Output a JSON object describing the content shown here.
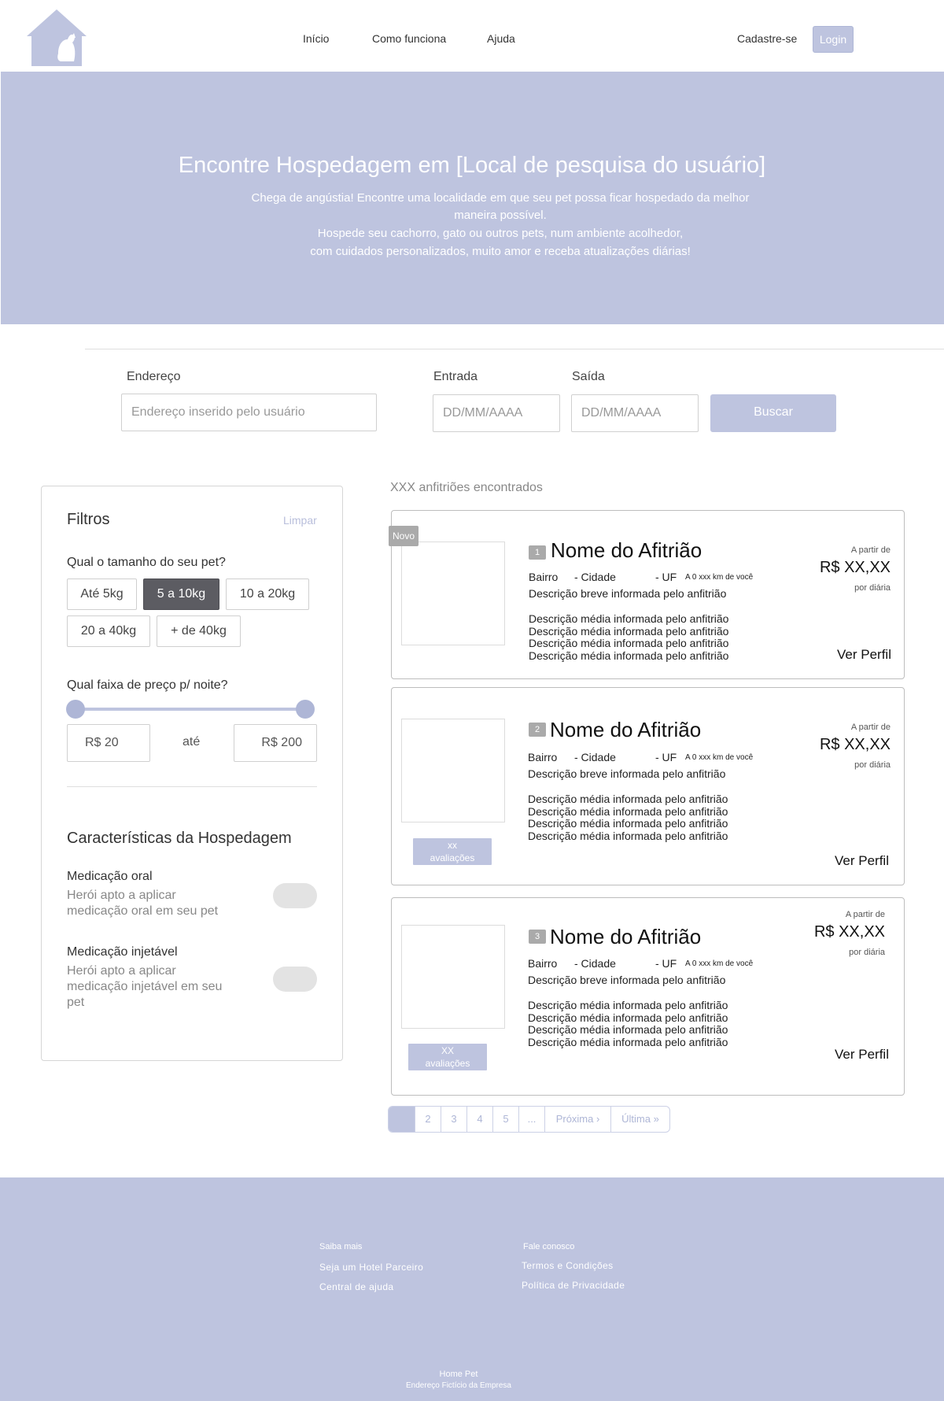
{
  "header": {
    "logo_icon": "house-dog-logo-icon",
    "nav": [
      {
        "label": "Início"
      },
      {
        "label": "Como funciona"
      },
      {
        "label": "Ajuda"
      }
    ],
    "signup_label": "Cadastre-se",
    "login_label": "Login"
  },
  "hero": {
    "title": "Encontre Hospedagem em [Local de pesquisa do usuário]",
    "line1": "Chega de angústia! Encontre uma localidade em que seu pet possa ficar hospedado da melhor",
    "line2": "maneira possível.",
    "line3": "Hospede seu cachorro, gato ou outros pets, num ambiente acolhedor,",
    "line4": "com cuidados personalizados, muito amor e receba atualizações diárias!"
  },
  "search": {
    "address_label": "Endereço",
    "address_value": "Endereço inserido pelo usuário",
    "checkin_label": "Entrada",
    "checkin_placeholder": "DD/MM/AAAA",
    "checkout_label": "Saída",
    "checkout_placeholder": "DD/MM/AAAA",
    "search_button": "Buscar"
  },
  "filters": {
    "title": "Filtros",
    "clear_label": "Limpar",
    "size_question": "Qual o tamanho do seu pet?",
    "sizes": [
      {
        "label": "Até 5kg",
        "selected": false
      },
      {
        "label": "5 a 10kg",
        "selected": true
      },
      {
        "label": "10 a 20kg",
        "selected": false
      },
      {
        "label": "20 a 40kg",
        "selected": false
      },
      {
        "label": "+ de 40kg",
        "selected": false
      }
    ],
    "price_question": "Qual faixa de preço p/ noite?",
    "price_min": "R$ 20",
    "price_to": "até",
    "price_max": "R$ 200",
    "slider_min_fraction": 0,
    "slider_max_fraction": 1,
    "features_title": "Características da Hospedagem",
    "features": [
      {
        "name": "Medicação oral",
        "desc1": "Herói apto a aplicar",
        "desc2": "medicação oral em seu pet",
        "desc3": "",
        "enabled": false
      },
      {
        "name": "Medicação injetável",
        "desc1": "Herói apto a aplicar",
        "desc2": "medicação injetável em seu",
        "desc3": "pet",
        "enabled": false
      }
    ]
  },
  "results": {
    "count_label": "XXX anfitriões encontrados",
    "new_badge": "Novo",
    "cards": [
      {
        "rank": "1",
        "name": "Nome do Afitrião",
        "bairro": "Bairro",
        "cidade": "- Cidade",
        "uf": "- UF",
        "distance": "A 0 xxx km de você",
        "desc_short": "Descrição breve informada pelo anfitrião",
        "desc_medium": [
          "Descrição média informada pelo anfitrião",
          "Descrição média informada pelo anfitrião",
          "Descrição média informada pelo anfitrião",
          "Descrição média informada pelo anfitrião"
        ],
        "price_from": "A partir de",
        "price": "R$ XX,XX",
        "per_night": "por diária",
        "profile_link": "Ver Perfil"
      },
      {
        "rank": "2",
        "name": "Nome do Afitrião",
        "bairro": "Bairro",
        "cidade": "- Cidade",
        "uf": "- UF",
        "distance": "A 0 xxx km de você",
        "desc_short": "Descrição breve informada pelo anfitrião",
        "desc_medium": [
          "Descrição média informada pelo anfitrião",
          "Descrição média informada pelo anfitrião",
          "Descrição média informada pelo anfitrião",
          "Descrição média informada pelo anfitrião"
        ],
        "price_from": "A partir de",
        "price": "R$ XX,XX",
        "per_night": "por diária",
        "profile_link": "Ver Perfil",
        "reviews_line1": "xx",
        "reviews_line2": "avaliações"
      },
      {
        "rank": "3",
        "name": "Nome do Afitrião",
        "bairro": "Bairro",
        "cidade": "- Cidade",
        "uf": "- UF",
        "distance": "A 0 xxx km de você",
        "desc_short": "Descrição breve informada pelo anfitrião",
        "desc_medium": [
          "Descrição média informada pelo anfitrião",
          "Descrição média informada pelo anfitrião",
          "Descrição média informada pelo anfitrião",
          "Descrição média informada pelo anfitrião"
        ],
        "price_from": "A partir de",
        "price": "R$ XX,XX",
        "per_night": "por diária",
        "profile_link": "Ver Perfil",
        "reviews_line1": "XX",
        "reviews_line2": "avaliações"
      }
    ]
  },
  "pagination": {
    "current": "",
    "pages": [
      "2",
      "3",
      "4",
      "5",
      "..."
    ],
    "next": "Próxima ›",
    "last": "Última »"
  },
  "footer": {
    "col1_title": "Saiba mais",
    "col1_links": [
      "Seja um Hotel Parceiro",
      "Central de ajuda"
    ],
    "col2_title": "Fale conosco",
    "col2_links": [
      "Termos e Condições",
      "Política de Privacidade"
    ],
    "company": "Home Pet",
    "address": "Endereço Fictício da Empresa"
  },
  "colors": {
    "accent": "#bec4df",
    "selected_chip": "#5c5c62",
    "border": "#bdbdbd"
  }
}
